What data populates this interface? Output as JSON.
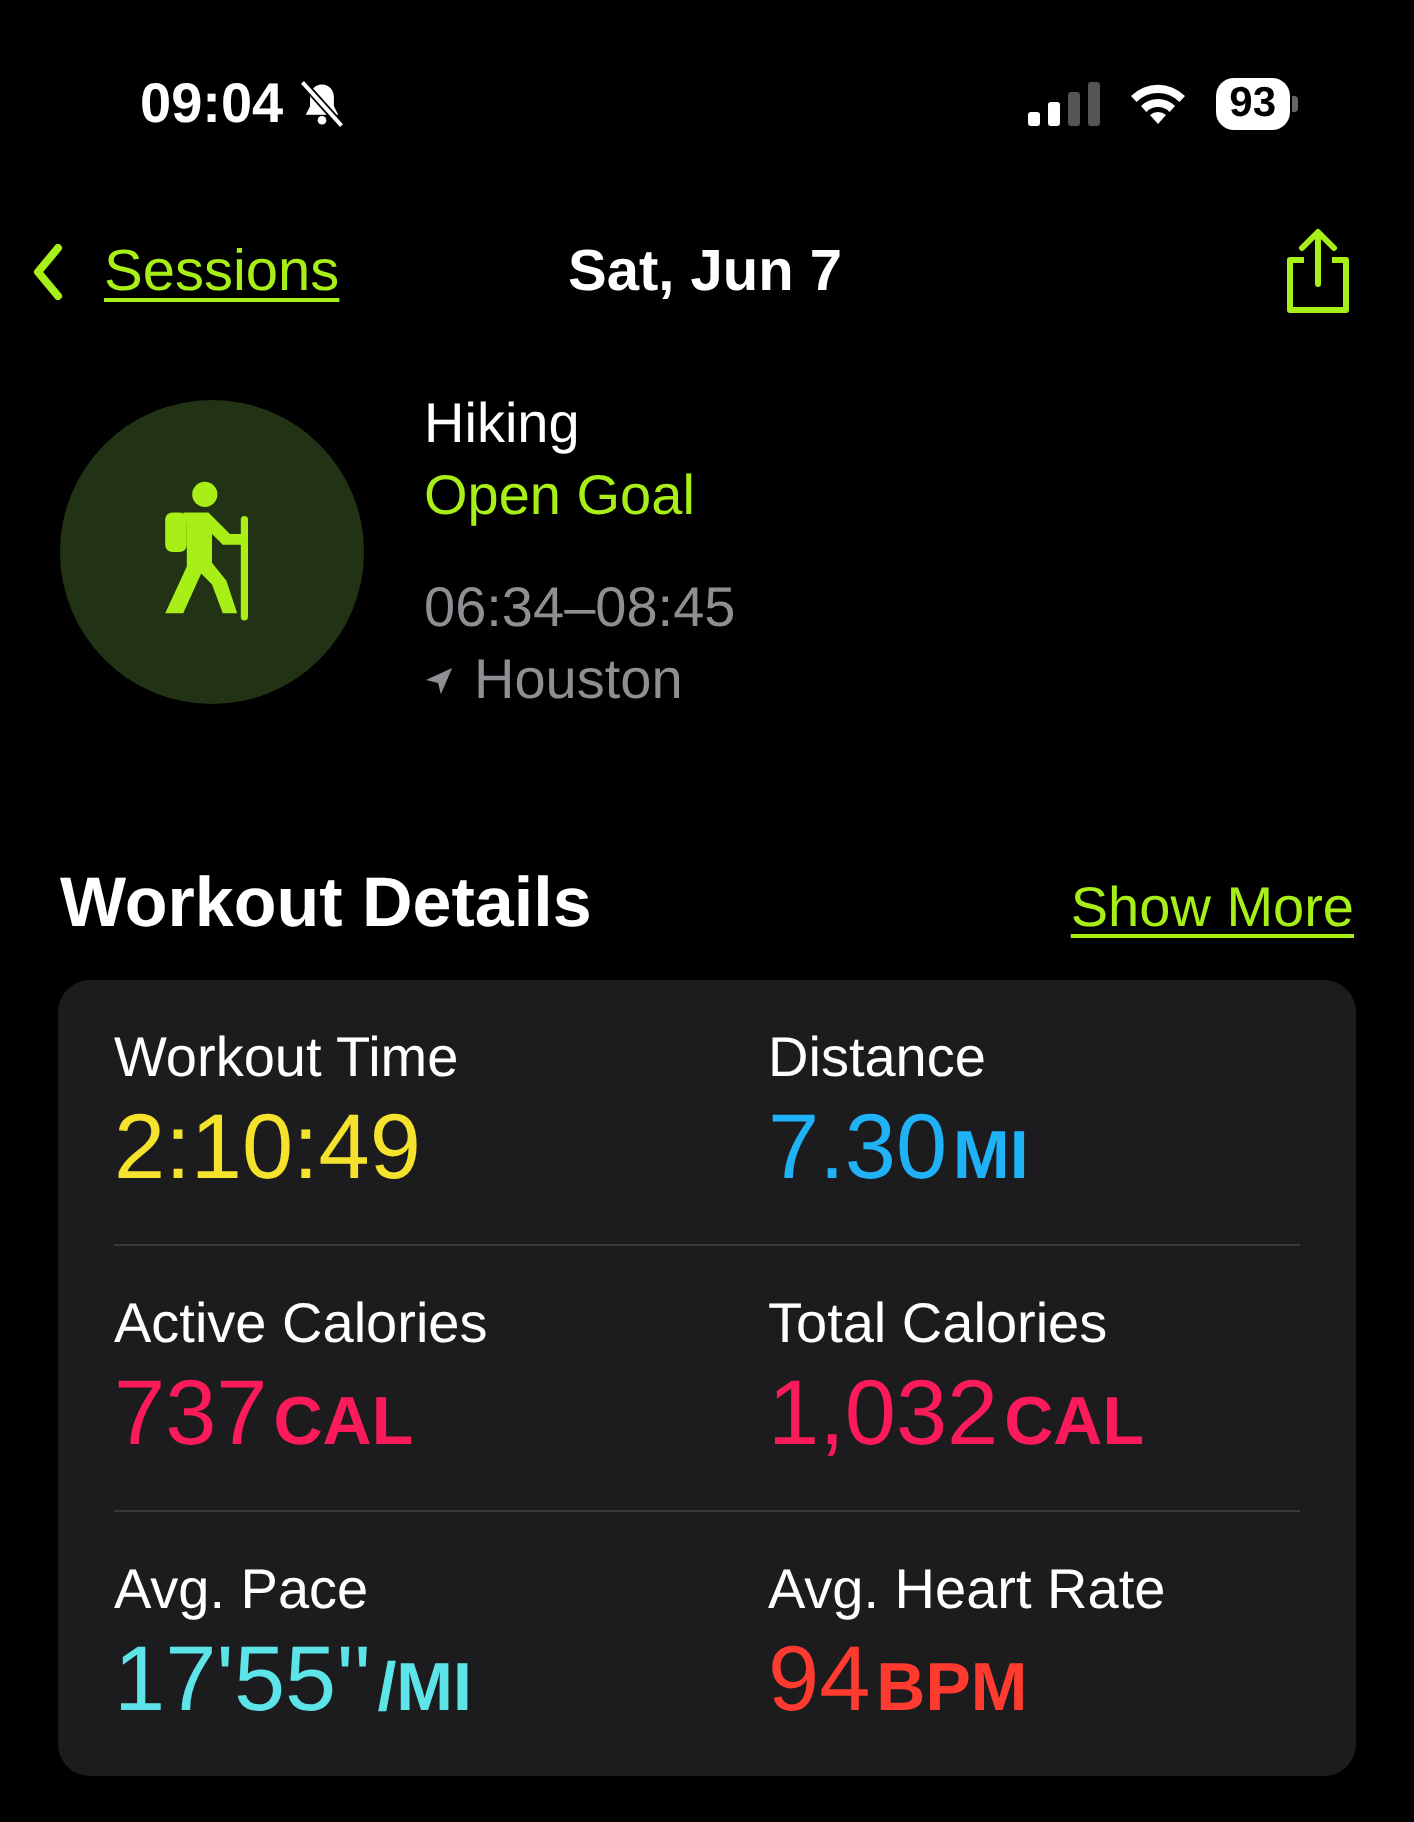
{
  "status_bar": {
    "time": "09:04",
    "silent": true,
    "battery": "93"
  },
  "nav": {
    "back": "Sessions",
    "title": "Sat, Jun 7"
  },
  "workout": {
    "type": "Hiking",
    "goal": "Open Goal",
    "time_range": "06:34–08:45",
    "location": "Houston"
  },
  "details": {
    "title": "Workout Details",
    "link": "Show More",
    "metrics": [
      {
        "label": "Workout Time",
        "value": "2:10:49",
        "color": "#f4e22c"
      },
      {
        "label": "Distance",
        "value": "7.30",
        "unit": "MI",
        "color": "#20b2f7"
      },
      {
        "label": "Active Calories",
        "value": "737",
        "unit": "CAL",
        "color": "#fb1b5b"
      },
      {
        "label": "Total Calories",
        "value": "1,032",
        "unit": "CAL",
        "color": "#fb1b5b"
      },
      {
        "label": "Avg. Pace",
        "value": "17'55''",
        "unit": "/MI",
        "color": "#5ce4e8"
      },
      {
        "label": "Avg. Heart Rate",
        "value": "94",
        "unit": "BPM",
        "color": "#ff3a2e"
      }
    ]
  }
}
